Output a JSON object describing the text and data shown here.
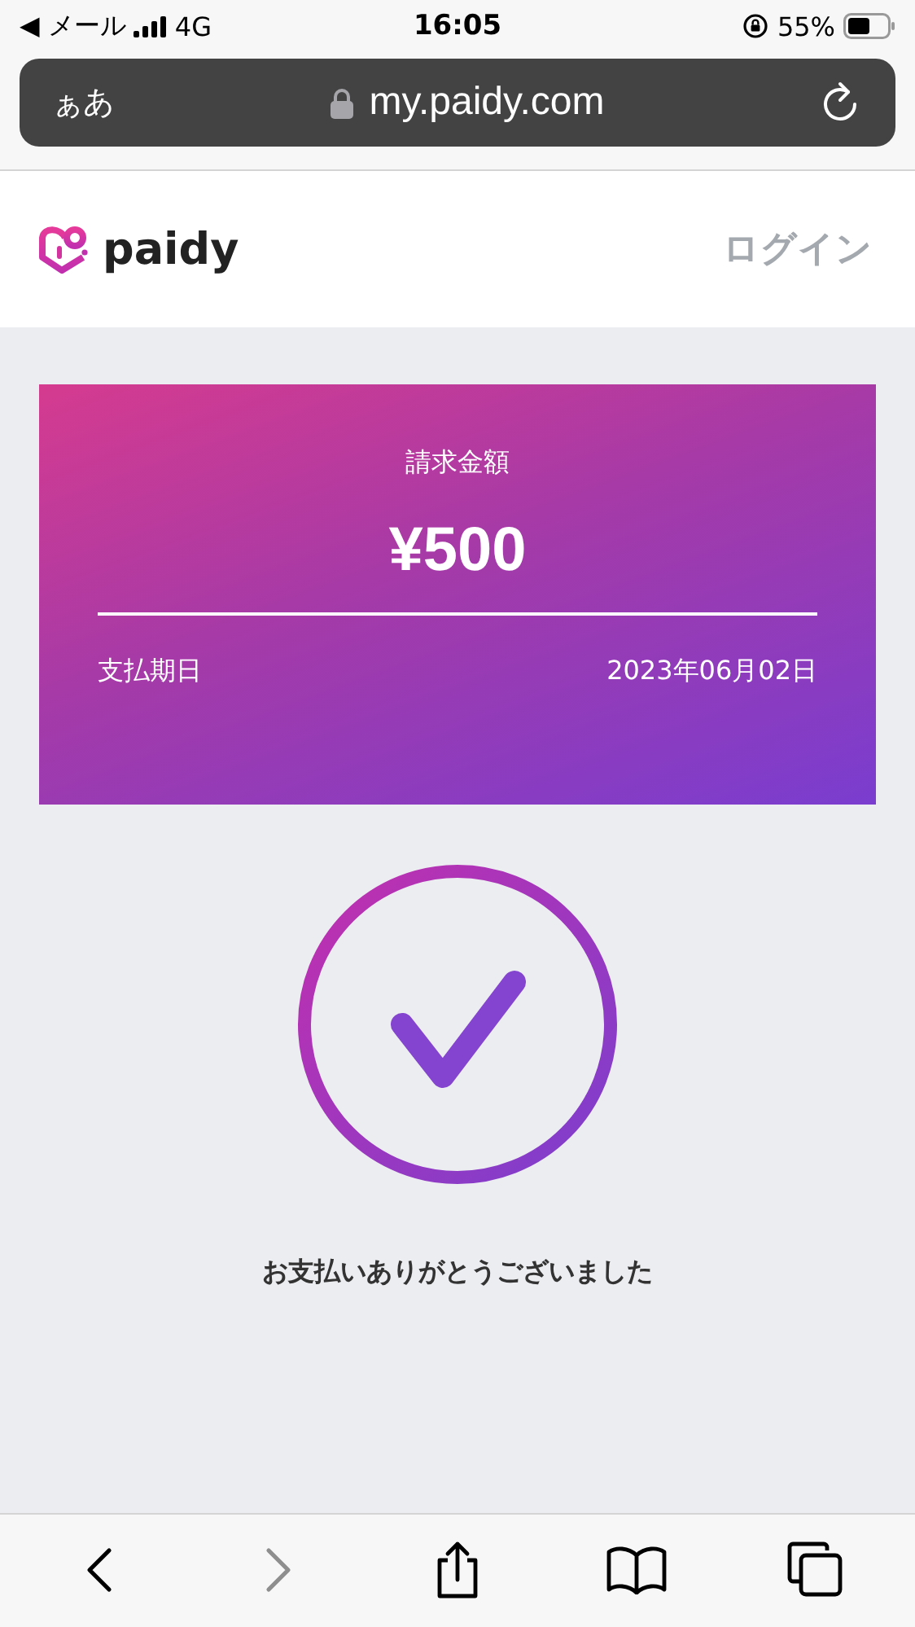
{
  "status_bar": {
    "back_app": "◀ メール",
    "network": "4G",
    "time": "16:05",
    "battery": "55%"
  },
  "address_bar": {
    "text_size": "ぁあ",
    "url": "my.paidy.com"
  },
  "header": {
    "brand": "paidy",
    "login": "ログイン"
  },
  "bill": {
    "label": "請求金額",
    "amount": "¥500",
    "due_label": "支払期日",
    "due_date": "2023年06月02日"
  },
  "message": "お支払いありがとうございました",
  "toolbar": [
    {
      "kind": "back",
      "disabled": false
    },
    {
      "kind": "forward",
      "disabled": true
    },
    {
      "kind": "share",
      "disabled": false
    },
    {
      "kind": "bookmarks",
      "disabled": false
    },
    {
      "kind": "tabs",
      "disabled": false
    }
  ]
}
